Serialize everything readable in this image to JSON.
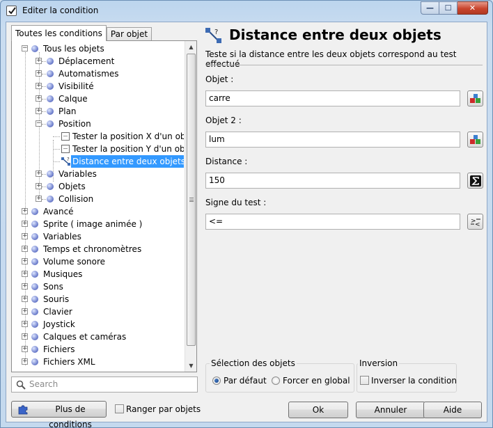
{
  "window": {
    "title": "Editer la condition",
    "buttons": {
      "minimize": "—",
      "maximize": "☐",
      "close": "✕"
    }
  },
  "tabs": [
    {
      "label": "Toutes les conditions",
      "active": true
    },
    {
      "label": "Par objet",
      "active": false
    }
  ],
  "tree": {
    "root": "Tous les objets",
    "items": [
      {
        "label": "Déplacement"
      },
      {
        "label": "Automatismes"
      },
      {
        "label": "Visibilité"
      },
      {
        "label": "Calque"
      },
      {
        "label": "Plan"
      },
      {
        "label": "Position"
      },
      {
        "label": "Tester la position X d'un objet"
      },
      {
        "label": "Tester la position Y d'un objet"
      },
      {
        "label": "Distance entre deux objets",
        "selected": true
      },
      {
        "label": "Variables"
      },
      {
        "label": "Objets"
      },
      {
        "label": "Collision"
      }
    ],
    "top_level": [
      "Avancé",
      "Sprite ( image animée )",
      "Variables",
      "Temps et chronomètres",
      "Volume sonore",
      "Musiques",
      "Sons",
      "Souris",
      "Clavier",
      "Joystick",
      "Calques et caméras",
      "Fichiers",
      "Fichiers XML"
    ]
  },
  "search": {
    "placeholder": "Search"
  },
  "condition": {
    "title": "Distance entre deux objets",
    "description": "Teste si la distance entre les deux objets correspond au test effectué",
    "params": [
      {
        "label": "Objet :",
        "value": "carre",
        "button_icon": "objects-icon"
      },
      {
        "label": "Objet 2 :",
        "value": "lum",
        "button_icon": "objects-icon"
      },
      {
        "label": "Distance :",
        "value": "150",
        "button_icon": "sigma-icon"
      },
      {
        "label": "Signe du test :",
        "value": "<=",
        "button_icon": "comparison-icon"
      }
    ]
  },
  "selection": {
    "title": "Sélection des objets",
    "options": [
      {
        "label": "Par défaut",
        "checked": true
      },
      {
        "label": "Forcer en global",
        "checked": false
      }
    ]
  },
  "inversion": {
    "title": "Inversion",
    "checkbox_label": "Inverser la condition",
    "checked": false
  },
  "footer": {
    "more_conditions": "Plus de conditions",
    "sort_by_objects": "Ranger par objets",
    "ok": "Ok",
    "cancel": "Annuler",
    "help": "Aide"
  }
}
